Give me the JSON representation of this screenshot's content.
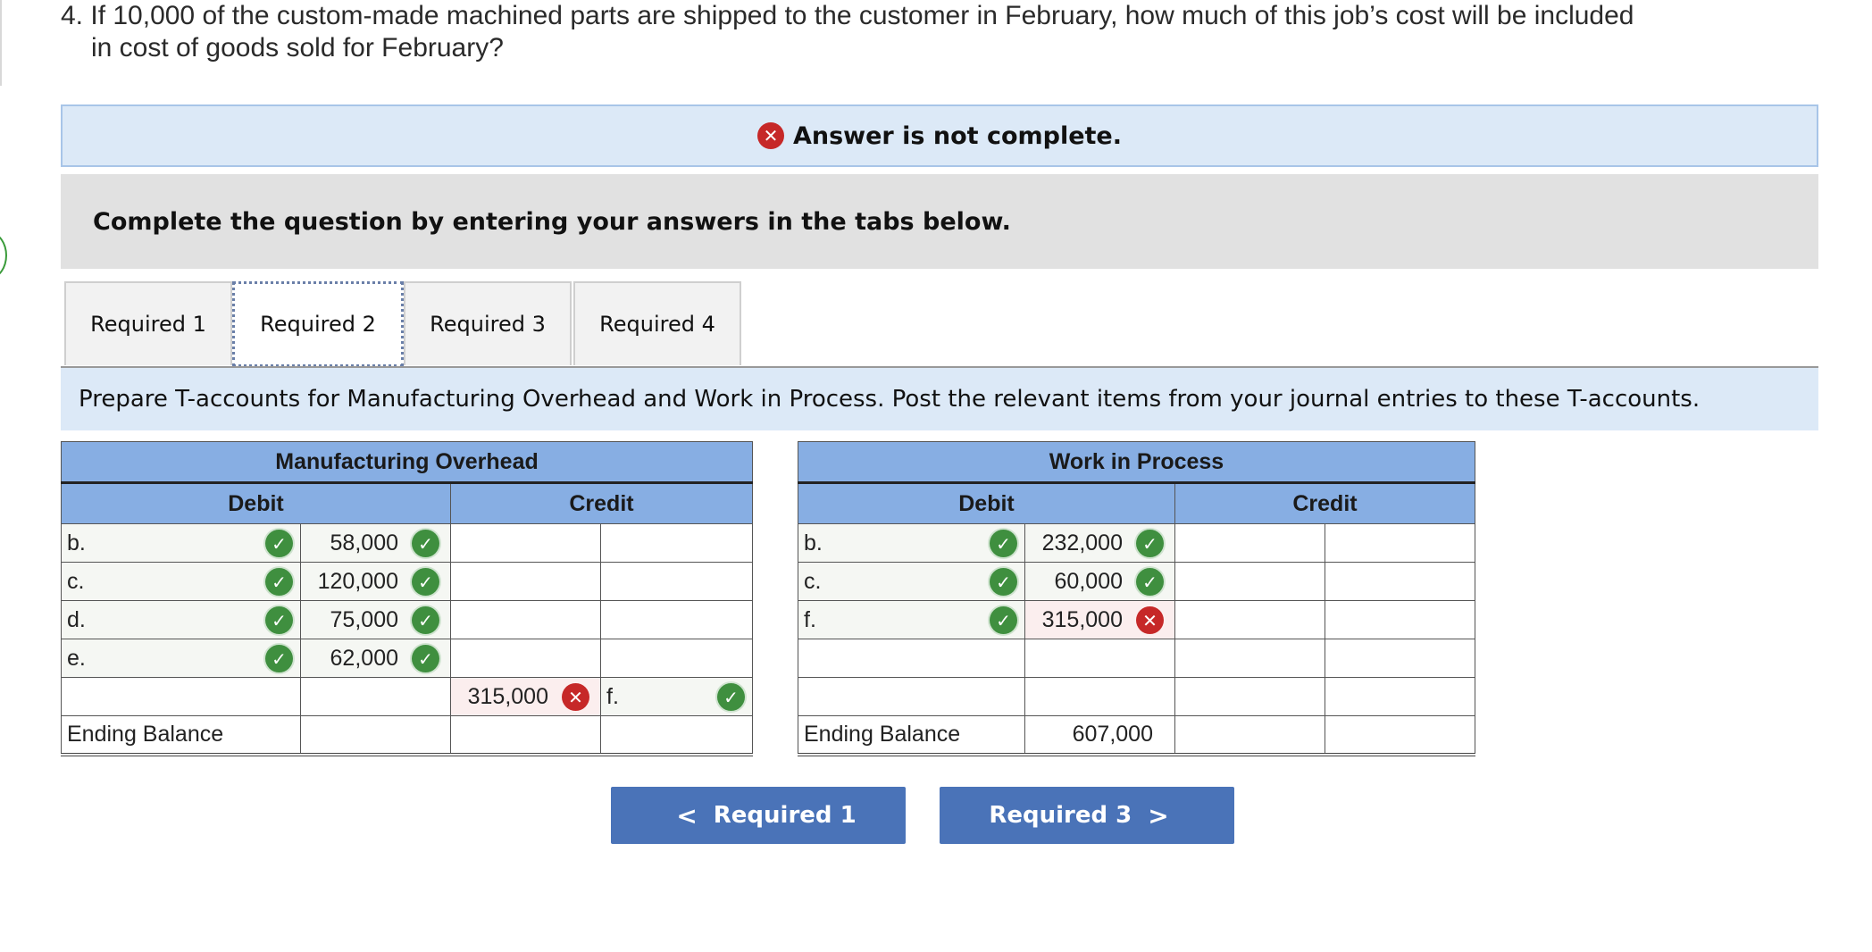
{
  "question": {
    "line1": "4. If 10,000 of the custom-made machined parts are shipped to the customer in February, how much of this job’s cost will be included",
    "line2": "in cost of goods sold for February?"
  },
  "status": {
    "icon": "x-circle-icon",
    "text": "Answer is not complete."
  },
  "instruction": "Complete the question by entering your answers in the tabs below.",
  "tabs": [
    {
      "label": "Required 1",
      "active": false
    },
    {
      "label": "Required 2",
      "active": true
    },
    {
      "label": "Required 3",
      "active": false
    },
    {
      "label": "Required 4",
      "active": false
    }
  ],
  "prompt": "Prepare T-accounts for Manufacturing Overhead and Work in Process. Post the relevant items from your journal entries to these T-accounts.",
  "mfg_overhead": {
    "title": "Manufacturing Overhead",
    "debit_label": "Debit",
    "credit_label": "Credit",
    "debits": [
      {
        "label": "b.",
        "amount": "58,000",
        "status": "correct"
      },
      {
        "label": "c.",
        "amount": "120,000",
        "status": "correct"
      },
      {
        "label": "d.",
        "amount": "75,000",
        "status": "correct"
      },
      {
        "label": "e.",
        "amount": "62,000",
        "status": "correct"
      }
    ],
    "credits": [
      {
        "amount": "315,000",
        "amount_status": "incorrect",
        "label": "f.",
        "label_status": "correct"
      }
    ],
    "ending_label": "Ending Balance",
    "ending_debit": "",
    "ending_credit": ""
  },
  "wip": {
    "title": "Work in Process",
    "debit_label": "Debit",
    "credit_label": "Credit",
    "debits": [
      {
        "label": "b.",
        "amount": "232,000",
        "status": "correct"
      },
      {
        "label": "c.",
        "amount": "60,000",
        "status": "correct"
      },
      {
        "label": "f.",
        "amount": "315,000",
        "status": "incorrect"
      }
    ],
    "ending_label": "Ending Balance",
    "ending_debit": "607,000",
    "ending_credit": ""
  },
  "nav": {
    "prev_label": "Required 1",
    "next_label": "Required 3",
    "prev_icon": "chevron-left-icon",
    "next_icon": "chevron-right-icon"
  },
  "colors": {
    "header_blue": "#87aee3",
    "banner_blue": "#dce9f7",
    "button_blue": "#4a73b8",
    "correct_green": "#3f8f3f",
    "incorrect_red": "#c62828"
  }
}
